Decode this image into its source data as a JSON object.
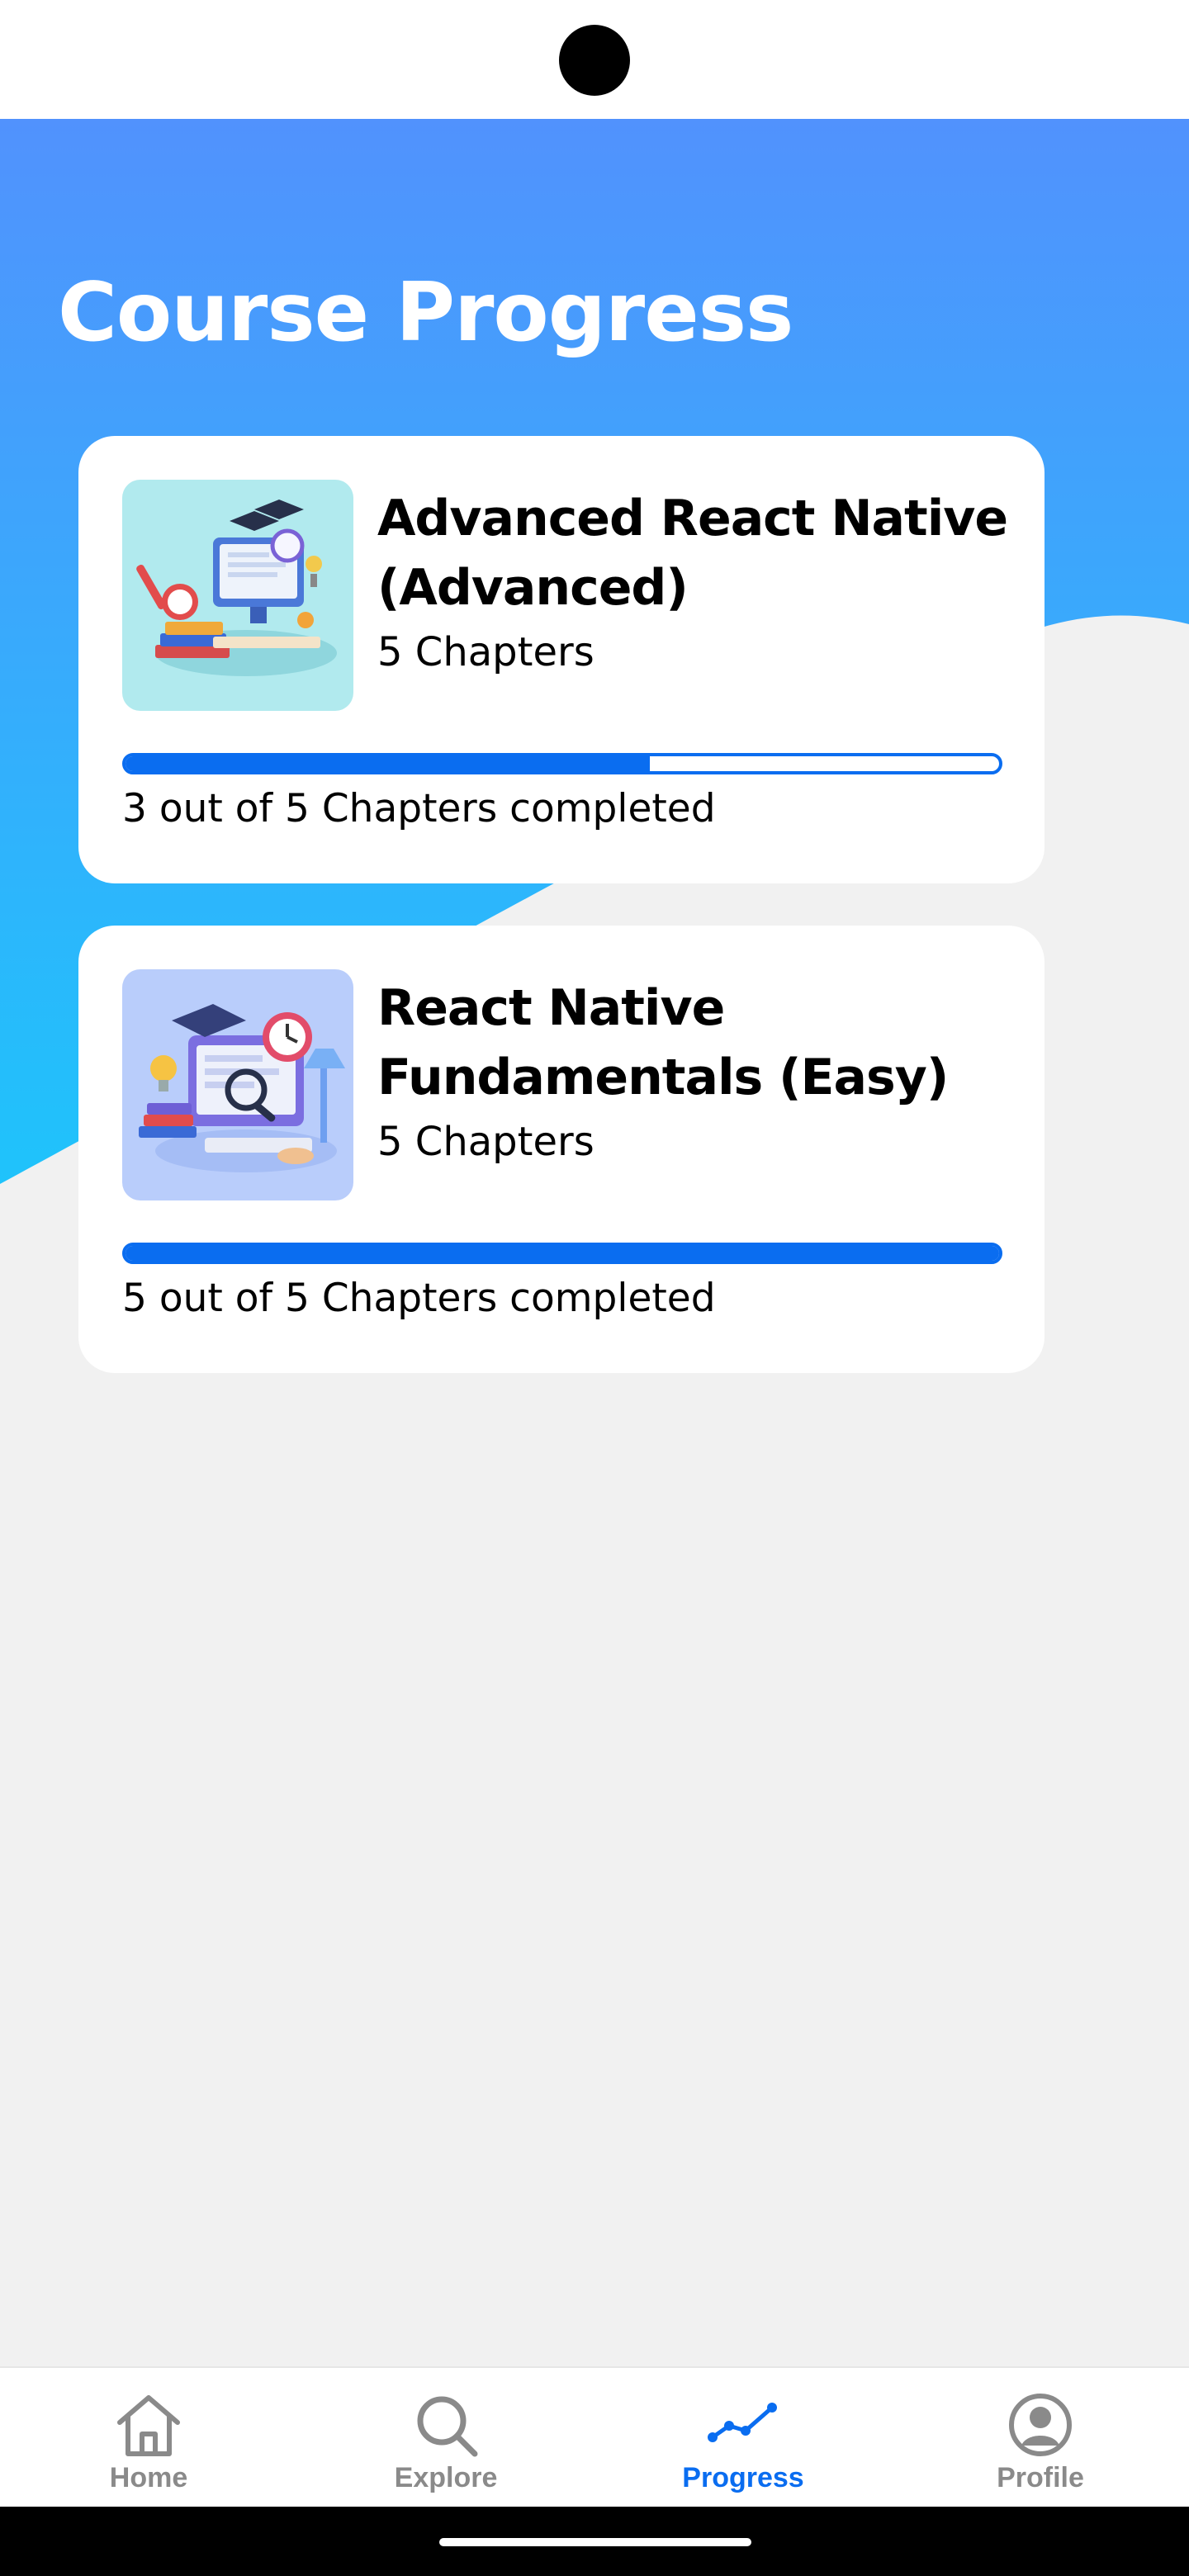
{
  "page": {
    "title": "Course Progress"
  },
  "courses": [
    {
      "title": "Advanced React Native (Advanced)",
      "chapters_label": "5 Chapters",
      "progress_label": "3 out of 5 Chapters completed",
      "completed": 3,
      "total": 5
    },
    {
      "title": "React Native Fundamentals (Easy)",
      "chapters_label": "5 Chapters",
      "progress_label": "5 out of 5 Chapters completed",
      "completed": 5,
      "total": 5
    }
  ],
  "nav": {
    "items": [
      {
        "label": "Home",
        "icon": "home-icon",
        "active": false
      },
      {
        "label": "Explore",
        "icon": "search-icon",
        "active": false
      },
      {
        "label": "Progress",
        "icon": "progress-chart-icon",
        "active": true
      },
      {
        "label": "Profile",
        "icon": "profile-icon",
        "active": false
      }
    ]
  },
  "colors": {
    "accent": "#0a6df0",
    "gradient_top": "#5192fd",
    "gradient_bottom": "#1fc3fb",
    "background": "#f1f1f1",
    "inactive": "#8a8a8a"
  }
}
